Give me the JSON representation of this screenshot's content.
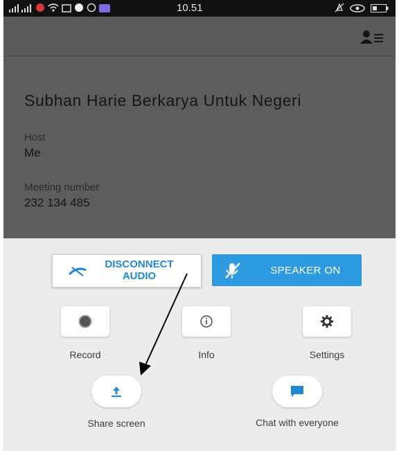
{
  "status_bar": {
    "time": "10.51",
    "signal_icon": "signal-icon",
    "wifi_icon": "wifi-icon",
    "eye_icon": "eye-icon",
    "battery_icon": "battery-icon"
  },
  "meeting": {
    "title": "Subhan Harie Berkarya Untuk Negeri",
    "host_label": "Host",
    "host_value": "Me",
    "number_label": "Meeting number",
    "number_value": "232 134 485"
  },
  "controls": {
    "disconnect_label": "DISCONNECT AUDIO",
    "speaker_label": "SPEAKER ON",
    "record_label": "Record",
    "info_label": "Info",
    "settings_label": "Settings",
    "share_label": "Share screen",
    "chat_label": "Chat with everyone"
  },
  "colors": {
    "accent": "#2d9be0",
    "panel": "#5d5d5d",
    "sheet": "#ececec"
  }
}
